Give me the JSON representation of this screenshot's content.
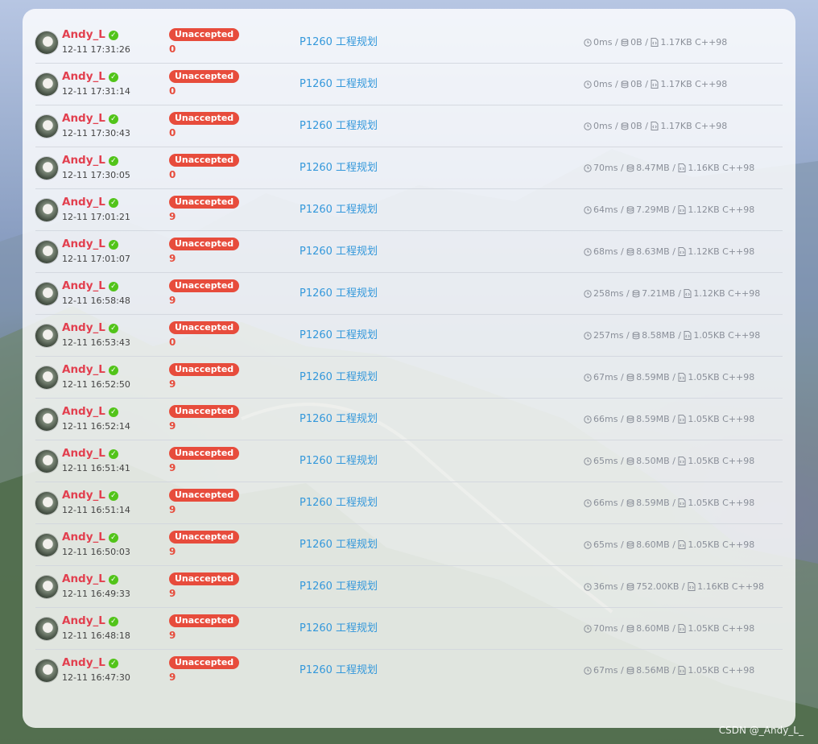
{
  "submissions": [
    {
      "user": "Andy_L",
      "time": "12-11 17:31:26",
      "status": "Unaccepted",
      "score": "0",
      "problem": "P1260 工程规划",
      "runtime": "0ms",
      "memory": "0B",
      "code_size": "1.17KB",
      "lang": "C++98"
    },
    {
      "user": "Andy_L",
      "time": "12-11 17:31:14",
      "status": "Unaccepted",
      "score": "0",
      "problem": "P1260 工程规划",
      "runtime": "0ms",
      "memory": "0B",
      "code_size": "1.17KB",
      "lang": "C++98"
    },
    {
      "user": "Andy_L",
      "time": "12-11 17:30:43",
      "status": "Unaccepted",
      "score": "0",
      "problem": "P1260 工程规划",
      "runtime": "0ms",
      "memory": "0B",
      "code_size": "1.17KB",
      "lang": "C++98"
    },
    {
      "user": "Andy_L",
      "time": "12-11 17:30:05",
      "status": "Unaccepted",
      "score": "0",
      "problem": "P1260 工程规划",
      "runtime": "70ms",
      "memory": "8.47MB",
      "code_size": "1.16KB",
      "lang": "C++98"
    },
    {
      "user": "Andy_L",
      "time": "12-11 17:01:21",
      "status": "Unaccepted",
      "score": "9",
      "problem": "P1260 工程规划",
      "runtime": "64ms",
      "memory": "7.29MB",
      "code_size": "1.12KB",
      "lang": "C++98"
    },
    {
      "user": "Andy_L",
      "time": "12-11 17:01:07",
      "status": "Unaccepted",
      "score": "9",
      "problem": "P1260 工程规划",
      "runtime": "68ms",
      "memory": "8.63MB",
      "code_size": "1.12KB",
      "lang": "C++98"
    },
    {
      "user": "Andy_L",
      "time": "12-11 16:58:48",
      "status": "Unaccepted",
      "score": "9",
      "problem": "P1260 工程规划",
      "runtime": "258ms",
      "memory": "7.21MB",
      "code_size": "1.12KB",
      "lang": "C++98"
    },
    {
      "user": "Andy_L",
      "time": "12-11 16:53:43",
      "status": "Unaccepted",
      "score": "0",
      "problem": "P1260 工程规划",
      "runtime": "257ms",
      "memory": "8.58MB",
      "code_size": "1.05KB",
      "lang": "C++98"
    },
    {
      "user": "Andy_L",
      "time": "12-11 16:52:50",
      "status": "Unaccepted",
      "score": "9",
      "problem": "P1260 工程规划",
      "runtime": "67ms",
      "memory": "8.59MB",
      "code_size": "1.05KB",
      "lang": "C++98"
    },
    {
      "user": "Andy_L",
      "time": "12-11 16:52:14",
      "status": "Unaccepted",
      "score": "9",
      "problem": "P1260 工程规划",
      "runtime": "66ms",
      "memory": "8.59MB",
      "code_size": "1.05KB",
      "lang": "C++98"
    },
    {
      "user": "Andy_L",
      "time": "12-11 16:51:41",
      "status": "Unaccepted",
      "score": "9",
      "problem": "P1260 工程规划",
      "runtime": "65ms",
      "memory": "8.50MB",
      "code_size": "1.05KB",
      "lang": "C++98"
    },
    {
      "user": "Andy_L",
      "time": "12-11 16:51:14",
      "status": "Unaccepted",
      "score": "9",
      "problem": "P1260 工程规划",
      "runtime": "66ms",
      "memory": "8.59MB",
      "code_size": "1.05KB",
      "lang": "C++98"
    },
    {
      "user": "Andy_L",
      "time": "12-11 16:50:03",
      "status": "Unaccepted",
      "score": "9",
      "problem": "P1260 工程规划",
      "runtime": "65ms",
      "memory": "8.60MB",
      "code_size": "1.05KB",
      "lang": "C++98"
    },
    {
      "user": "Andy_L",
      "time": "12-11 16:49:33",
      "status": "Unaccepted",
      "score": "9",
      "problem": "P1260 工程规划",
      "runtime": "36ms",
      "memory": "752.00KB",
      "code_size": "1.16KB",
      "lang": "C++98"
    },
    {
      "user": "Andy_L",
      "time": "12-11 16:48:18",
      "status": "Unaccepted",
      "score": "9",
      "problem": "P1260 工程规划",
      "runtime": "70ms",
      "memory": "8.60MB",
      "code_size": "1.05KB",
      "lang": "C++98"
    },
    {
      "user": "Andy_L",
      "time": "12-11 16:47:30",
      "status": "Unaccepted",
      "score": "9",
      "problem": "P1260 工程规划",
      "runtime": "67ms",
      "memory": "8.56MB",
      "code_size": "1.05KB",
      "lang": "C++98"
    }
  ],
  "separator": "/",
  "watermark": "CSDN @_Andy_L_",
  "icons": {
    "verified": "check-circle-icon",
    "runtime": "clock-icon",
    "memory": "database-icon",
    "code_size": "file-code-icon"
  },
  "colors": {
    "user": "#e2404f",
    "status_badge": "#e74c3c",
    "score": "#e74c3c",
    "problem_link": "#3498db",
    "verified": "#52c41a"
  }
}
